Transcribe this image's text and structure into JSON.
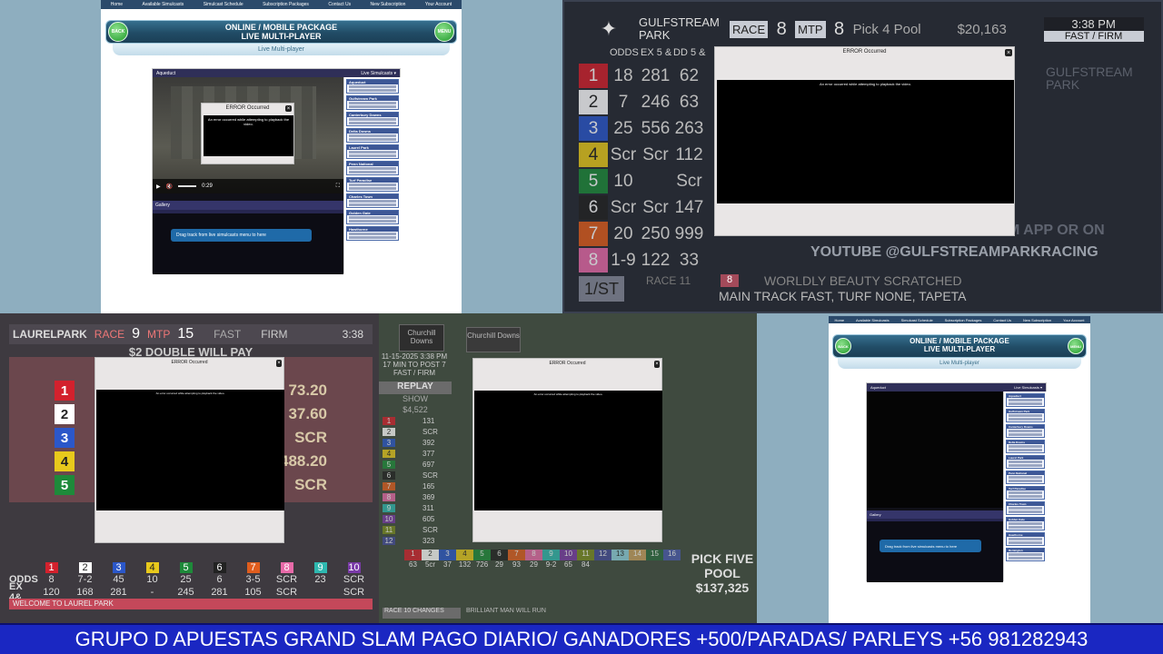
{
  "nav_items": [
    "Home",
    "Available Simulcasts",
    "Simulcast Schedule",
    "Subscription Packages",
    "Contact Us",
    "New Subscription",
    "Your Account"
  ],
  "package_banner": {
    "title": "ONLINE / MOBILE PACKAGE",
    "subtitle": "LIVE MULTI-PLAYER",
    "back": "BACK",
    "menu": "MENU",
    "bar": "Live Multi-player"
  },
  "player": {
    "track": "Aqueduct",
    "live_simulcasts": "Live Simulcasts ▾",
    "time": "0:29",
    "gallery": "Gallery",
    "drag_text": "Drag track from live simulcasts menu to here",
    "sim_items": [
      "Aqueduct",
      "Gulfstream Park",
      "Canterbury Downs",
      "Delta Downs",
      "Laurel Park",
      "Penn National",
      "Turf Paradise",
      "Charles Town",
      "Golden Gate",
      "Hawthorne",
      "Remington"
    ]
  },
  "error": {
    "title": "ERROR Occurred",
    "message": "An error occurred while attempting to playback the video.",
    "close": "×"
  },
  "gulfstream": {
    "logo": "GULFSTREAM PARK",
    "race_label": "RACE",
    "race": "8",
    "mtp_label": "MTP",
    "mtp": "8",
    "pool_label": "Pick 4 Pool",
    "pool": "$20,163",
    "clock": "3:38 PM",
    "cond_fast": "FAST",
    "cond_firm": "FIRM",
    "headers": [
      "ODDS",
      "EX 5 &",
      "DD 5 &"
    ],
    "rows": [
      {
        "n": "1",
        "odds": "18",
        "ex": "281",
        "dd": "62",
        "c": "#d3212d"
      },
      {
        "n": "2",
        "odds": "7",
        "ex": "246",
        "dd": "63",
        "c": "#ffffff"
      },
      {
        "n": "3",
        "odds": "25",
        "ex": "556",
        "dd": "263",
        "c": "#2b57c9"
      },
      {
        "n": "4",
        "odds": "Scr",
        "ex": "Scr",
        "dd": "112",
        "c": "#e8c91c"
      },
      {
        "n": "5",
        "odds": "10",
        "ex": "",
        "dd": "Scr",
        "c": "#1e8a3a"
      },
      {
        "n": "6",
        "odds": "Scr",
        "ex": "Scr",
        "dd": "147",
        "c": "#222222"
      },
      {
        "n": "7",
        "odds": "20",
        "ex": "250",
        "dd": "999",
        "c": "#e05d1d"
      },
      {
        "n": "8",
        "odds": "1-9",
        "ex": "122",
        "dd": "33",
        "c": "#e86aa9"
      }
    ],
    "first_label": "1/ST",
    "race11": "RACE 11",
    "listen": "LISTEN IN THE GULFSTREAM APP OR ON",
    "youtube": "YOUTUBE @GULFSTREAMPARKRACING",
    "scratch_num": "8",
    "scratch": "WORLDLY BEAUTY SCRATCHED",
    "main_track": "MAIN TRACK FAST, TURF NONE, TAPETA"
  },
  "laurel": {
    "logo": "LAURELPARK",
    "race_label": "RACE",
    "race": "9",
    "mtp_label": "MTP",
    "mtp": "15",
    "fast": "FAST",
    "firm": "FIRM",
    "clock": "3:38",
    "header": "$2 DOUBLE WILL PAY",
    "pays": [
      {
        "n": "1",
        "v": "73.20",
        "c": "#d3212d"
      },
      {
        "n": "2",
        "v": "37.60",
        "c": "#ffffff"
      },
      {
        "n": "3",
        "v": "SCR",
        "c": "#2b57c9"
      },
      {
        "n": "4",
        "v": "488.20",
        "c": "#e8c91c"
      },
      {
        "n": "5",
        "v": "SCR",
        "c": "#1e8a3a"
      }
    ],
    "odds_label": "ODDS",
    "ex_label": "EX 4&",
    "odds": [
      "8",
      "7-2",
      "45",
      "10",
      "25",
      "6",
      "3-5",
      "SCR",
      "23",
      "SCR"
    ],
    "ex": [
      "120",
      "168",
      "281",
      "-",
      "245",
      "281",
      "105",
      "SCR",
      "",
      "SCR"
    ],
    "welcome": "WELCOME TO LAUREL PARK"
  },
  "churchill": {
    "logo": "Churchill Downs",
    "date": "11-15-2025",
    "time": "3:38 PM",
    "mtp": "17 MIN TO POST 7",
    "cond_fast": "FAST",
    "cond_firm": "FIRM",
    "replay": "REPLAY",
    "show": "SHOW",
    "show_total": "$4,522",
    "show_vals": [
      "131",
      "SCR",
      "392",
      "377",
      "697",
      "SCR",
      "165",
      "369",
      "311",
      "605",
      "SCR",
      "323"
    ],
    "odds": [
      "63",
      "5cr",
      "37",
      "132",
      "726",
      "29",
      "93",
      "29",
      "9-2",
      "65",
      "84"
    ],
    "pick_five": "PICK FIVE",
    "pool": "POOL",
    "pool_amt": "$137,325",
    "changes": "RACE 10 CHANGES",
    "horse": "BRILLIANT MAN WILL RUN"
  },
  "ticker": "GRUPO D APUESTAS GRAND SLAM PAGO DIARIO/ GANADORES +500/PARADAS/ PARLEYS +56 981282943"
}
